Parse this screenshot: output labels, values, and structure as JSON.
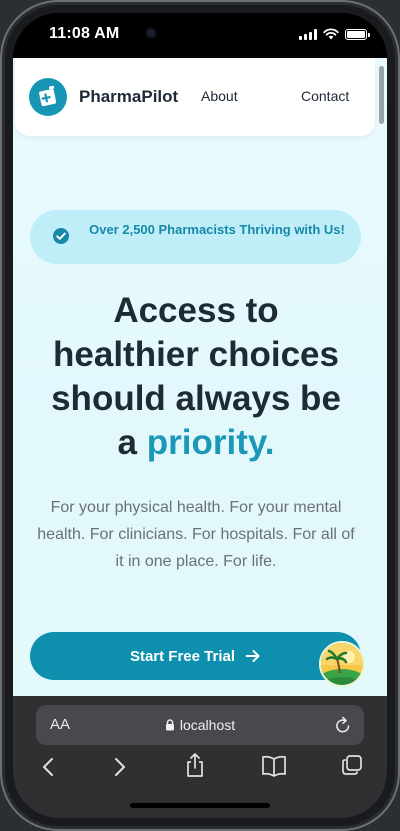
{
  "status_bar": {
    "time": "11:08 AM"
  },
  "nav": {
    "brand": "PharmaPilot",
    "links": [
      "About",
      "Contact"
    ]
  },
  "badge": {
    "text": "Over 2,500 Pharmacists Thriving with Us!"
  },
  "hero": {
    "title_line1": "Access to",
    "title_line2": "healthier choices",
    "title_line3": "should always be",
    "title_prefix": "a",
    "title_highlight": "priority."
  },
  "subtitle": "For your physical health. For your mental health. For clinicians. For hospitals. For all of it in one place. For life.",
  "cta": {
    "label": "Start Free Trial"
  },
  "browser": {
    "text_size_label": "AA",
    "url": "localhost"
  },
  "colors": {
    "brand": "#1795b2",
    "cta": "#0f8fae",
    "highlight": "#1b98b7",
    "badge_bg": "#bfeef8"
  },
  "icons": [
    "logo-icon",
    "check-circle-icon",
    "arrow-right-icon",
    "assistant-avatar-icon",
    "lock-icon",
    "reload-icon",
    "back-icon",
    "forward-icon",
    "share-icon",
    "bookmarks-icon",
    "tabs-icon"
  ]
}
